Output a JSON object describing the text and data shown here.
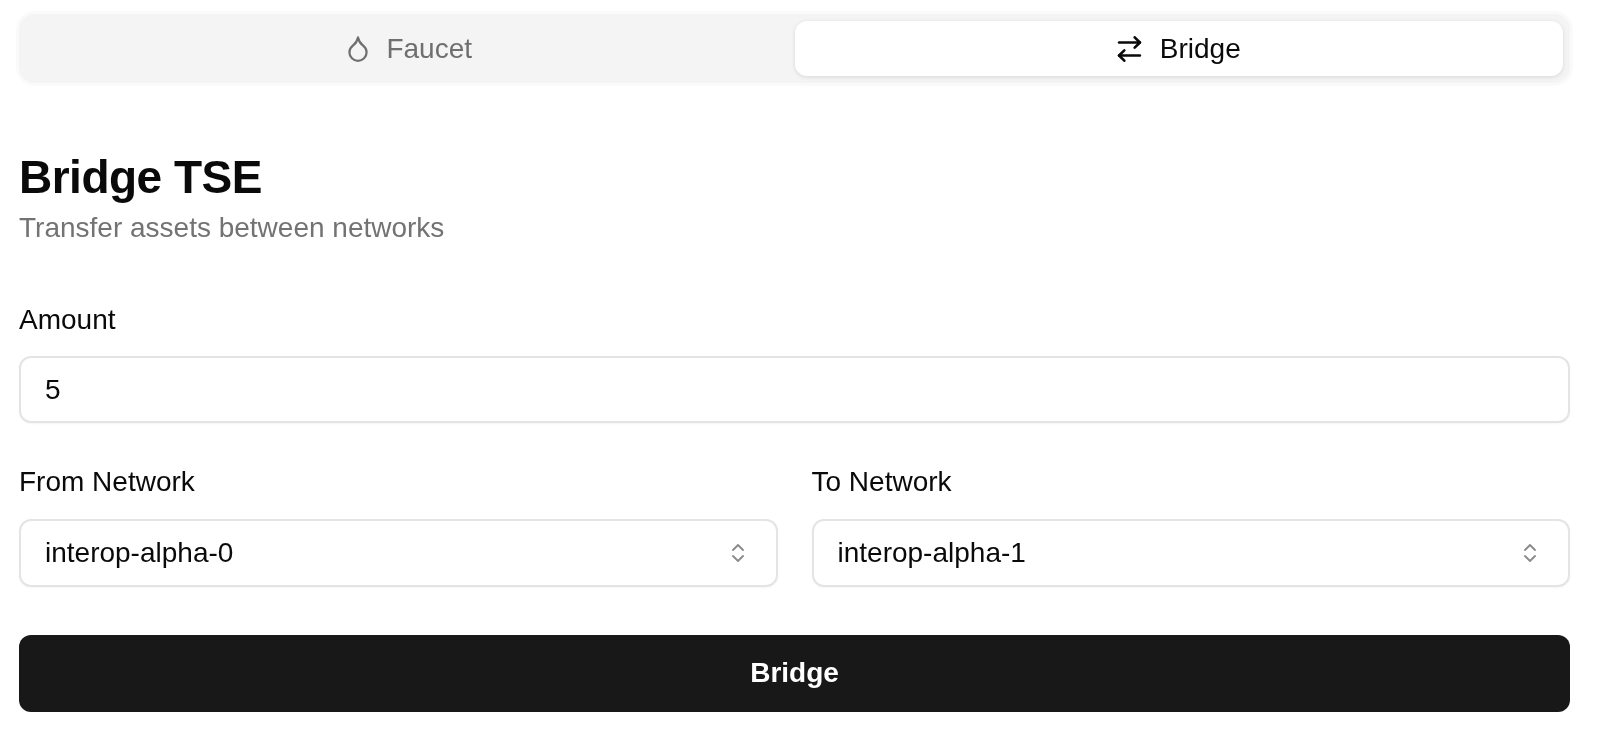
{
  "tabs": [
    {
      "label": "Faucet",
      "selected": false
    },
    {
      "label": "Bridge",
      "selected": true
    }
  ],
  "header": {
    "title": "Bridge TSE",
    "subtitle": "Transfer assets between networks"
  },
  "amount": {
    "label": "Amount",
    "value": "5"
  },
  "networks": [
    {
      "label": "From Network",
      "value": "interop-alpha-0"
    },
    {
      "label": "To Network",
      "value": "interop-alpha-1"
    }
  ],
  "submit_button": "Bridge"
}
